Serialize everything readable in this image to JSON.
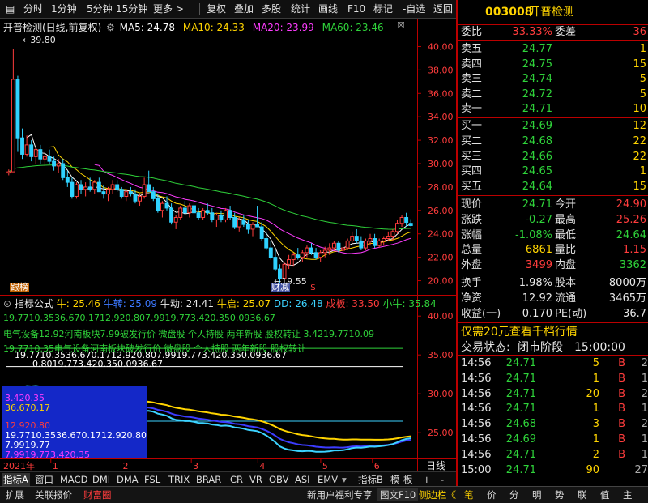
{
  "toolbar": {
    "items": [
      "分时",
      "1分钟",
      "5分钟",
      "15分钟",
      "更多 >",
      "复权",
      "叠加",
      "多股",
      "统计",
      "画线",
      "F10",
      "标记",
      "-自选",
      "返回"
    ]
  },
  "main_chart": {
    "title": "开普检测(日线,前复权)",
    "ma": [
      {
        "label": "MA5: 24.78",
        "color": "#ffffff"
      },
      {
        "label": "MA10: 24.33",
        "color": "#ffd400"
      },
      {
        "label": "MA20: 23.99",
        "color": "#ff3cff"
      },
      {
        "label": "MA60: 23.46",
        "color": "#2fd23a"
      }
    ],
    "high_label": "39.80",
    "low_label": "19.55",
    "left_marker": "跟榜",
    "mid_marker": "财减",
    "small_marker": "$",
    "y_ticks": [
      "40.00",
      "38.00",
      "36.00",
      "34.00",
      "32.00",
      "30.00",
      "28.00",
      "26.00",
      "24.00",
      "22.00",
      "20.00"
    ]
  },
  "indicator": {
    "title": "指标公式",
    "values": [
      {
        "label": "牛: 25.46",
        "color": "#ffd400"
      },
      {
        "label": "牛转: 25.09",
        "color": "#3c78ff"
      },
      {
        "label": "牛动: 24.41",
        "color": "#e8e8e8"
      },
      {
        "label": "牛启: 25.07",
        "color": "#ffd400"
      },
      {
        "label": "DD: 26.48",
        "color": "#3cd2ff"
      },
      {
        "label": "成板: 33.50",
        "color": "#ff3c3c"
      },
      {
        "label": "小牛: 35.84",
        "color": "#2fd23a"
      }
    ],
    "y_ticks": [
      "40.00",
      "35.00",
      "30.00",
      "25.00"
    ],
    "line1": "19.7710.3536.670.1712.920.807.9919.773.420.350.0936.67",
    "line2": "电气设备12.92河南板块7.99破发行价 微盘股 个人持股 两年新股 股权转让 3.4219.7710.09",
    "line3": "19.7710.35电气设备河南板块破发行价 微盘股 个人持股 两年新股 股权转让",
    "line4": "19.7710.3536.670.1712.920.807.9919.773.420.350.0936.67",
    "line5": "0.8019.773.420.350.0936.67",
    "box": {
      "l1": "3.420.35",
      "l2": "36.670.17",
      "l3": "12.920.80",
      "l4": "19.7710.3536.670.1712.920.80",
      "l5": "7.9919.77",
      "l6": "7.9919.773.420.35"
    }
  },
  "xaxis": {
    "year": "2021年",
    "months": [
      "1",
      "2",
      "3",
      "4",
      "5",
      "6"
    ],
    "right_label": "日线"
  },
  "tabs": [
    "指标A",
    "窗口",
    "MACD",
    "DMI",
    "DMA",
    "FSL",
    "TRIX",
    "BRAR",
    "CR",
    "VR",
    "OBV",
    "ASI",
    "EMV",
    "指标B",
    "模",
    "板",
    "+",
    "-"
  ],
  "bottombar": {
    "left": [
      "扩展",
      "关联报价",
      "财富圈"
    ],
    "right": [
      "新用户福利专享",
      "图文F10",
      "侧边栏《"
    ],
    "icons": [
      "笔",
      "价",
      "分",
      "明",
      "势",
      "联",
      "值",
      "主"
    ]
  },
  "quote": {
    "code": "003008",
    "name": "开普检测",
    "weibi_label": "委比",
    "weibi": "33.33%",
    "weicha_label": "委差",
    "weicha": "36",
    "asks": [
      {
        "label": "卖五",
        "price": "24.77",
        "vol": "1"
      },
      {
        "label": "卖四",
        "price": "24.75",
        "vol": "15"
      },
      {
        "label": "卖三",
        "price": "24.74",
        "vol": "5"
      },
      {
        "label": "卖二",
        "price": "24.72",
        "vol": "5"
      },
      {
        "label": "卖一",
        "price": "24.71",
        "vol": "10"
      }
    ],
    "bids": [
      {
        "label": "买一",
        "price": "24.69",
        "vol": "12"
      },
      {
        "label": "买二",
        "price": "24.68",
        "vol": "22"
      },
      {
        "label": "买三",
        "price": "24.66",
        "vol": "22"
      },
      {
        "label": "买四",
        "price": "24.65",
        "vol": "1"
      },
      {
        "label": "买五",
        "price": "24.64",
        "vol": "15"
      }
    ],
    "stats": [
      {
        "l1": "现价",
        "v1": "24.71",
        "c1": "grn",
        "l2": "今开",
        "v2": "24.90",
        "c2": "red"
      },
      {
        "l1": "涨跌",
        "v1": "-0.27",
        "c1": "grn",
        "l2": "最高",
        "v2": "25.26",
        "c2": "red"
      },
      {
        "l1": "涨幅",
        "v1": "-1.08%",
        "c1": "grn",
        "l2": "最低",
        "v2": "24.64",
        "c2": "grn"
      },
      {
        "l1": "总量",
        "v1": "6861",
        "c1": "yel",
        "l2": "量比",
        "v2": "1.15",
        "c2": "red"
      },
      {
        "l1": "外盘",
        "v1": "3499",
        "c1": "red",
        "l2": "内盘",
        "v2": "3362",
        "c2": "grn"
      }
    ],
    "stats2": [
      {
        "l1": "换手",
        "v1": "1.98%",
        "l2": "股本",
        "v2": "8000万"
      },
      {
        "l1": "净资",
        "v1": "12.92",
        "l2": "流通",
        "v2": "3465万"
      },
      {
        "l1": "收益(一)",
        "v1": "0.170",
        "l2": "PE(动)",
        "v2": "36.7"
      }
    ],
    "promo": "仅需20元查看千档行情",
    "status_label": "交易状态:",
    "status": "闭市阶段",
    "status_time": "15:00:00",
    "trades": [
      {
        "t": "14:56",
        "p": "24.71",
        "v": "5",
        "s": "B",
        "n": "2"
      },
      {
        "t": "14:56",
        "p": "24.71",
        "v": "1",
        "s": "B",
        "n": "1"
      },
      {
        "t": "14:56",
        "p": "24.71",
        "v": "20",
        "s": "B",
        "n": "2"
      },
      {
        "t": "14:56",
        "p": "24.71",
        "v": "1",
        "s": "B",
        "n": "1"
      },
      {
        "t": "14:56",
        "p": "24.68",
        "v": "3",
        "s": "B",
        "n": "2"
      },
      {
        "t": "14:56",
        "p": "24.69",
        "v": "1",
        "s": "B",
        "n": "1"
      },
      {
        "t": "14:56",
        "p": "24.71",
        "v": "2",
        "s": "B",
        "n": "1"
      },
      {
        "t": "15:00",
        "p": "24.71",
        "v": "90",
        "s": "",
        "n": "27"
      }
    ]
  },
  "chart_data": {
    "type": "candlestick",
    "ylim": [
      19,
      41
    ],
    "candles": [
      [
        29.2,
        29.5,
        29.0,
        29.3
      ],
      [
        29.3,
        39.8,
        29.3,
        37.2
      ],
      [
        37.2,
        37.5,
        31.0,
        32.2
      ],
      [
        32.2,
        33.0,
        30.4,
        30.8
      ],
      [
        30.8,
        32.4,
        30.6,
        31.6
      ],
      [
        31.6,
        32.0,
        30.2,
        30.6
      ],
      [
        30.6,
        31.4,
        30.0,
        31.2
      ],
      [
        31.2,
        31.6,
        30.0,
        30.4
      ],
      [
        30.4,
        31.0,
        29.8,
        30.6
      ],
      [
        30.6,
        31.2,
        30.0,
        30.2
      ],
      [
        30.2,
        30.6,
        29.4,
        29.8
      ],
      [
        29.8,
        30.4,
        29.2,
        30.0
      ],
      [
        30.0,
        30.4,
        28.6,
        28.8
      ],
      [
        28.8,
        29.4,
        28.0,
        28.4
      ],
      [
        28.4,
        28.8,
        27.0,
        27.2
      ],
      [
        27.2,
        28.4,
        27.0,
        28.2
      ],
      [
        28.2,
        28.6,
        27.4,
        27.8
      ],
      [
        27.8,
        28.4,
        27.2,
        28.0
      ],
      [
        28.0,
        28.8,
        27.6,
        27.8
      ],
      [
        27.8,
        28.6,
        27.4,
        28.4
      ],
      [
        28.4,
        28.8,
        27.6,
        27.6
      ],
      [
        27.6,
        28.2,
        27.0,
        27.4
      ],
      [
        27.4,
        28.0,
        26.8,
        27.8
      ],
      [
        27.8,
        28.6,
        27.4,
        28.2
      ],
      [
        28.2,
        28.6,
        27.6,
        27.8
      ],
      [
        27.8,
        28.0,
        27.0,
        27.2
      ],
      [
        27.2,
        27.8,
        26.8,
        27.6
      ],
      [
        27.6,
        28.0,
        27.2,
        27.4
      ],
      [
        27.4,
        27.8,
        26.6,
        26.8
      ],
      [
        26.8,
        27.4,
        26.4,
        27.2
      ],
      [
        27.2,
        28.8,
        27.0,
        28.2
      ],
      [
        28.2,
        29.4,
        27.6,
        27.6
      ],
      [
        27.6,
        28.0,
        26.8,
        27.0
      ],
      [
        27.0,
        27.4,
        25.8,
        26.0
      ],
      [
        26.0,
        26.8,
        25.4,
        26.6
      ],
      [
        26.6,
        27.2,
        26.0,
        26.2
      ],
      [
        26.2,
        26.6,
        24.8,
        25.0
      ],
      [
        25.0,
        25.6,
        24.4,
        25.4
      ],
      [
        25.4,
        26.4,
        25.2,
        26.2
      ],
      [
        26.2,
        26.8,
        25.6,
        25.8
      ],
      [
        25.8,
        26.6,
        25.4,
        26.4
      ],
      [
        26.4,
        26.8,
        25.6,
        25.8
      ],
      [
        25.8,
        26.2,
        25.2,
        25.4
      ],
      [
        25.4,
        26.2,
        25.2,
        26.0
      ],
      [
        26.0,
        26.6,
        25.6,
        25.8
      ],
      [
        25.8,
        26.2,
        25.0,
        25.2
      ],
      [
        25.2,
        25.8,
        24.6,
        25.6
      ],
      [
        25.6,
        26.0,
        25.0,
        25.2
      ],
      [
        25.2,
        26.2,
        25.0,
        26.0
      ],
      [
        26.0,
        26.4,
        25.2,
        25.4
      ],
      [
        25.4,
        25.8,
        24.4,
        24.6
      ],
      [
        24.6,
        25.4,
        24.2,
        25.2
      ],
      [
        25.2,
        25.6,
        24.6,
        24.8
      ],
      [
        24.8,
        25.2,
        24.0,
        24.4
      ],
      [
        24.4,
        25.0,
        23.8,
        24.8
      ],
      [
        24.8,
        26.4,
        24.6,
        24.6
      ],
      [
        24.6,
        25.0,
        23.4,
        23.6
      ],
      [
        23.6,
        24.2,
        22.6,
        22.8
      ],
      [
        22.8,
        23.4,
        21.8,
        22.0
      ],
      [
        22.0,
        22.6,
        20.8,
        21.0
      ],
      [
        21.0,
        21.4,
        19.55,
        20.2
      ],
      [
        20.2,
        21.6,
        20.0,
        21.4
      ],
      [
        21.4,
        22.2,
        21.0,
        21.8
      ],
      [
        21.8,
        22.4,
        21.2,
        22.2
      ],
      [
        22.2,
        22.8,
        21.8,
        22.0
      ],
      [
        22.0,
        22.6,
        21.6,
        22.4
      ],
      [
        22.4,
        23.0,
        22.0,
        22.8
      ],
      [
        22.8,
        23.2,
        22.2,
        22.4
      ],
      [
        22.4,
        22.8,
        21.8,
        22.0
      ],
      [
        22.0,
        22.6,
        21.6,
        22.4
      ],
      [
        22.4,
        22.9,
        22.0,
        22.6
      ],
      [
        22.6,
        23.2,
        22.2,
        22.8
      ],
      [
        22.8,
        23.4,
        22.6,
        23.2
      ],
      [
        23.2,
        23.4,
        22.4,
        22.6
      ],
      [
        22.6,
        23.0,
        22.2,
        22.8
      ],
      [
        22.8,
        23.6,
        22.6,
        23.4
      ],
      [
        23.4,
        24.2,
        23.2,
        23.8
      ],
      [
        23.8,
        24.4,
        23.2,
        23.4
      ],
      [
        23.4,
        23.8,
        22.6,
        22.8
      ],
      [
        22.8,
        23.6,
        22.6,
        23.4
      ],
      [
        23.4,
        24.0,
        23.0,
        23.6
      ],
      [
        23.6,
        24.0,
        22.8,
        23.0
      ],
      [
        23.0,
        23.6,
        22.8,
        23.4
      ],
      [
        23.4,
        23.8,
        23.0,
        23.6
      ],
      [
        23.6,
        24.2,
        23.4,
        23.8
      ],
      [
        23.8,
        24.4,
        23.4,
        24.2
      ],
      [
        24.2,
        25.2,
        24.0,
        24.9
      ],
      [
        24.9,
        25.6,
        24.6,
        25.4
      ],
      [
        25.4,
        25.8,
        24.6,
        24.98
      ],
      [
        24.9,
        25.26,
        24.64,
        24.71
      ]
    ]
  }
}
